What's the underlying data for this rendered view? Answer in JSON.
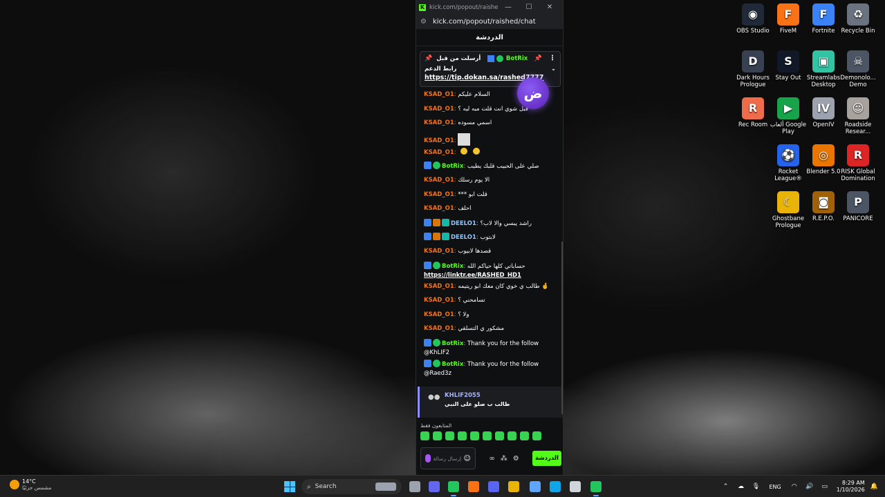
{
  "browser": {
    "tab_title": "kick.com/popout/raished/c...",
    "url": "kick.com/popout/raished/chat",
    "controls": {
      "minimize": "—",
      "maximize": "☐",
      "close": "✕"
    }
  },
  "chat": {
    "header": "الدردشة",
    "pinned": {
      "username": "BotRix",
      "pinned_by": "أرسلت من قبل",
      "line2": "رابط الدعم",
      "link": "https://tip.dokan.sa/rashed7777"
    },
    "messages": [
      {
        "user": "KSAD_O1",
        "color": "#f97316",
        "badges": [],
        "text": "السلام عليكم"
      },
      {
        "user": "KSAD_O1",
        "color": "#f97316",
        "badges": [],
        "text": "قبل شوي انت قلت مبه ليه ؟"
      },
      {
        "user": "KSAD_O1",
        "color": "#f97316",
        "badges": [],
        "text": "اسمي مسوده"
      },
      {
        "user": "KSAD_O1",
        "color": "#f97316",
        "badges": [],
        "text": "",
        "image": true
      },
      {
        "user": "KSAD_O1",
        "color": "#f97316",
        "badges": [],
        "text": "",
        "emotes": 2
      },
      {
        "user": "BotRix",
        "color": "#53fc18",
        "badges": [
          "b-blue",
          "b-green"
        ],
        "text": "صلي على الحبيب قلبك يطيب"
      },
      {
        "user": "KSAD_O1",
        "color": "#f97316",
        "badges": [],
        "text": "الا يوم رسلك"
      },
      {
        "user": "KSAD_O1",
        "color": "#f97316",
        "badges": [],
        "text": "*** قلت ابو"
      },
      {
        "user": "KSAD_O1",
        "color": "#f97316",
        "badges": [],
        "text": "احلف"
      },
      {
        "user": "DEELO1",
        "color": "#93c5fd",
        "badges": [
          "b-blue",
          "b-gold",
          "b-teal"
        ],
        "text": "راشد يبسي والا لاب؟"
      },
      {
        "user": "DEELO1",
        "color": "#93c5fd",
        "badges": [
          "b-blue",
          "b-gold",
          "b-teal"
        ],
        "text": "لابتوب"
      },
      {
        "user": "KSAD_O1",
        "color": "#f97316",
        "badges": [],
        "text": "قصدها لابيوب"
      },
      {
        "user": "BotRix",
        "color": "#53fc18",
        "badges": [
          "b-blue",
          "b-green"
        ],
        "text": "حساباتي كلها حياكم الله",
        "link": "https://linktr.ee/RASHED_HD1"
      },
      {
        "user": "KSAD_O1",
        "color": "#f97316",
        "badges": [],
        "text": "طالب ي خوي كان معك ابو ريتيمه 🤞"
      },
      {
        "user": "KSAD_O1",
        "color": "#f97316",
        "badges": [],
        "text": "تسامحني ؟"
      },
      {
        "user": "KSAD_O1",
        "color": "#f97316",
        "badges": [],
        "text": "ولا ؟"
      },
      {
        "user": "KSAD_O1",
        "color": "#f97316",
        "badges": [],
        "text": "مشكور ي التسلقي"
      },
      {
        "user": "BotRix",
        "color": "#53fc18",
        "badges": [
          "b-blue",
          "b-green"
        ],
        "text": "Thank you for the follow @KhLIF2"
      },
      {
        "user": "BotRix",
        "color": "#53fc18",
        "badges": [
          "b-blue",
          "b-green"
        ],
        "text": "Thank you for the follow @Raed3z"
      }
    ],
    "reply": {
      "user": "KHLIF2055",
      "text": "طالب ب صلو على النبي"
    },
    "emote_label": "المتابعون فقط",
    "input_placeholder": "إرسال رسالة",
    "send_button": "الدردشة"
  },
  "desktop_icons": [
    {
      "label": "OBS Studio",
      "color": "#1f2937",
      "glyph": "◉"
    },
    {
      "label": "FiveM",
      "color": "#f97316",
      "glyph": "F"
    },
    {
      "label": "Fortnite",
      "color": "#3b82f6",
      "glyph": "F"
    },
    {
      "label": "Recycle Bin",
      "color": "#6b7280",
      "glyph": "♻"
    },
    {
      "label": "Dark Hours Prologue",
      "color": "#374151",
      "glyph": "D"
    },
    {
      "label": "Stay Out",
      "color": "#111827",
      "glyph": "S"
    },
    {
      "label": "Streamlabs Desktop",
      "color": "#31c3a2",
      "glyph": "▣"
    },
    {
      "label": "Demonolo... Demo",
      "color": "#4b5563",
      "glyph": "☠"
    },
    {
      "label": "Rec Room",
      "color": "#ef6c4a",
      "glyph": "R"
    },
    {
      "label": "ألعاب Google Play",
      "color": "#16a34a",
      "glyph": "▶"
    },
    {
      "label": "OpenIV",
      "color": "#9ca3af",
      "glyph": "IV"
    },
    {
      "label": "Roadside Resear...",
      "color": "#a8a29e",
      "glyph": "☺"
    },
    {
      "label": "Rocket League®",
      "color": "#2563eb",
      "glyph": "⚽"
    },
    {
      "label": "Blender 5.0",
      "color": "#ea7600",
      "glyph": "◎"
    },
    {
      "label": "RISK Global Domination",
      "color": "#dc2626",
      "glyph": "R"
    },
    {
      "label": "Ghostbane Prologue",
      "color": "#eab308",
      "glyph": "☾"
    },
    {
      "label": "R.E.P.O.",
      "color": "#a16207",
      "glyph": "◙"
    },
    {
      "label": "PANICORE",
      "color": "#4b5563",
      "glyph": "P"
    }
  ],
  "taskbar": {
    "weather_temp": "14°C",
    "weather_desc": "مشمس جزئيًا",
    "search_label": "Search",
    "language": "ENG",
    "time": "8:29 AM",
    "date": "1/10/2026",
    "apps": [
      {
        "color": "#9ca3af"
      },
      {
        "color": "#6366f1"
      },
      {
        "color": "#22c55e"
      },
      {
        "color": "#f97316"
      },
      {
        "color": "#5865f2"
      },
      {
        "color": "#eab308"
      },
      {
        "color": "#60a5fa"
      },
      {
        "color": "#0ea5e9"
      },
      {
        "color": "#d1d5db"
      },
      {
        "color": "#22c55e"
      }
    ]
  }
}
